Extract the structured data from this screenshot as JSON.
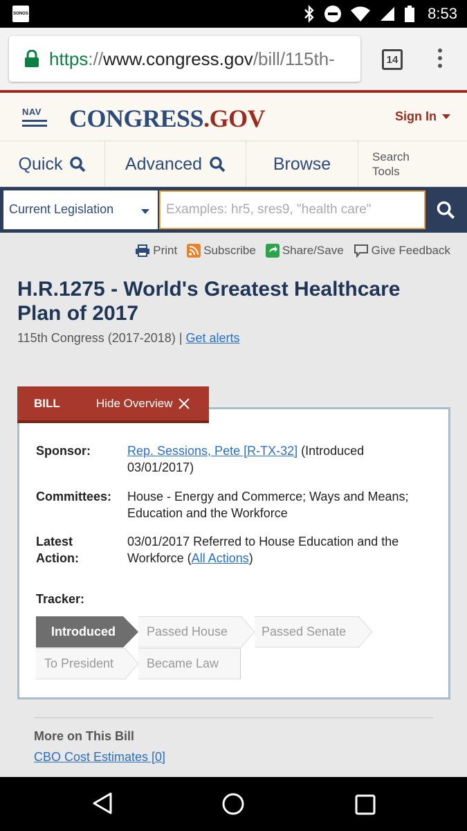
{
  "status_bar": {
    "notification_app": "SONOS",
    "time": "8:53"
  },
  "browser": {
    "url_scheme": "https",
    "url_sep": "://",
    "url_host": "www.congress.gov",
    "url_path": "/bill/115th-",
    "tab_count": "14"
  },
  "site": {
    "nav_label": "NAV",
    "logo_main": "CONGRESS",
    "logo_dot": ".",
    "logo_gov": "GOV",
    "sign_in": "Sign In"
  },
  "search_tabs": {
    "quick": "Quick",
    "advanced": "Advanced",
    "browse": "Browse",
    "tools_line1": "Search",
    "tools_line2": "Tools"
  },
  "search": {
    "scope": "Current Legislation",
    "placeholder": "Examples: hr5, sres9, \"health care\""
  },
  "page_tools": {
    "print": "Print",
    "subscribe": "Subscribe",
    "share": "Share/Save",
    "feedback": "Give Feedback"
  },
  "bill": {
    "title": "H.R.1275 - World's Greatest Healthcare Plan of 2017",
    "congress": "115th Congress (2017-2018)",
    "separator": " | ",
    "alerts_link": "Get alerts"
  },
  "overview": {
    "tab_label": "BILL",
    "hide_label": "Hide Overview",
    "sponsor_label": "Sponsor:",
    "sponsor_link": "Rep. Sessions, Pete [R-TX-32]",
    "sponsor_note": " (Introduced 03/01/2017)",
    "committees_label": "Committees:",
    "committees_value": "House - Energy and Commerce; Ways and Means; Education and the Workforce",
    "latest_label_1": "Latest",
    "latest_label_2": "Action:",
    "latest_value": "03/01/2017 Referred to House Education and the Workforce  (",
    "all_actions_link": "All Actions",
    "latest_close": ")",
    "tracker_label": "Tracker:",
    "tracker_steps": [
      "Introduced",
      "Passed House",
      "Passed Senate",
      "To President",
      "Became Law"
    ],
    "tracker_current": "Introduced"
  },
  "more": {
    "title": "More on This Bill",
    "cbo_link": "CBO Cost Estimates [0]"
  },
  "colors": {
    "brand_navy": "#2c4a7a",
    "brand_red": "#9b2c22",
    "link_blue": "#2c6fbf",
    "input_focus": "#e8a23b"
  }
}
